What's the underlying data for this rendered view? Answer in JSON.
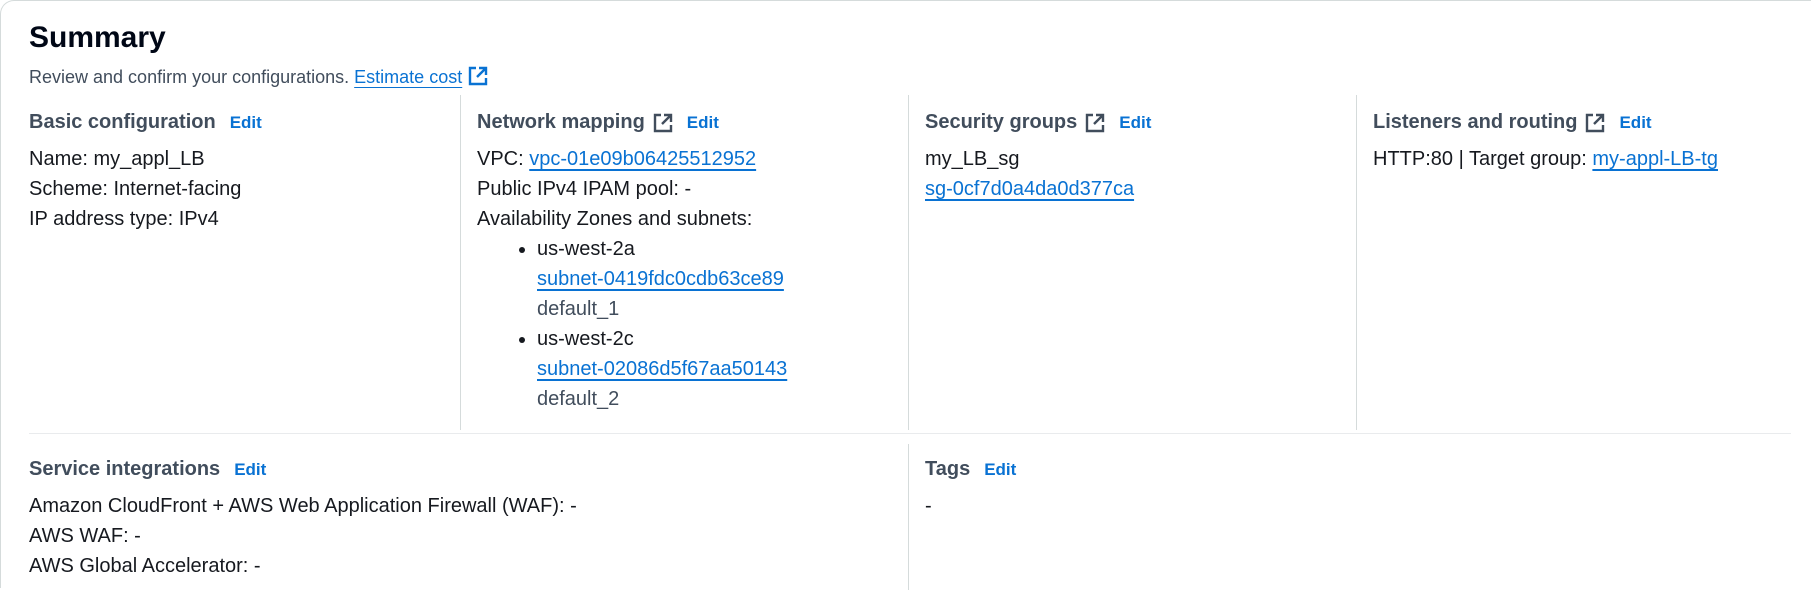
{
  "summary": {
    "title": "Summary",
    "subtitle": "Review and confirm your configurations.",
    "estimate_link": "Estimate cost"
  },
  "basic": {
    "heading": "Basic configuration",
    "edit": "Edit",
    "name": "Name: my_appl_LB",
    "scheme": "Scheme: Internet-facing",
    "ip_type": "IP address type: IPv4"
  },
  "network": {
    "heading": "Network mapping",
    "edit": "Edit",
    "vpc_label": "VPC:",
    "vpc_link": "vpc-01e09b06425512952",
    "ipam": "Public IPv4 IPAM pool: -",
    "az_label": "Availability Zones and subnets:",
    "zones": [
      {
        "zone": "us-west-2a",
        "subnet": "subnet-0419fdc0cdb63ce89",
        "name": "default_1"
      },
      {
        "zone": "us-west-2c",
        "subnet": "subnet-02086d5f67aa50143",
        "name": "default_2"
      }
    ]
  },
  "security": {
    "heading": "Security groups",
    "edit": "Edit",
    "group_name": "my_LB_sg",
    "group_link": "sg-0cf7d0a4da0d377ca"
  },
  "listeners": {
    "heading": "Listeners and routing",
    "edit": "Edit",
    "text": "HTTP:80 | Target group:",
    "tg_link": "my-appl-LB-tg"
  },
  "service": {
    "heading": "Service integrations",
    "edit": "Edit",
    "cloudfront": "Amazon CloudFront + AWS Web Application Firewall (WAF): -",
    "waf": "AWS WAF: -",
    "accelerator": "AWS Global Accelerator: -"
  },
  "tags": {
    "heading": "Tags",
    "edit": "Edit",
    "value": "-"
  },
  "colors": {
    "link": "#0972d3",
    "heading": "#414d5c",
    "text": "#16191f",
    "border": "#d5dbdb"
  }
}
